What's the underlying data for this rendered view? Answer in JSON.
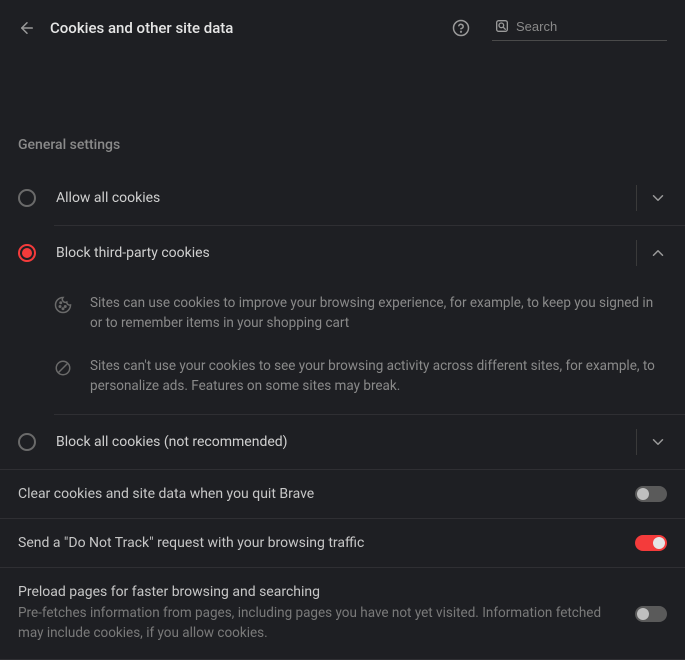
{
  "header": {
    "title": "Cookies and other site data",
    "search_placeholder": "Search"
  },
  "section_title": "General settings",
  "radios": {
    "allow_all": "Allow all cookies",
    "block_third": "Block third-party cookies",
    "block_all": "Block all cookies (not recommended)"
  },
  "block_third_details": {
    "line1": "Sites can use cookies to improve your browsing experience, for example, to keep you signed in or to remember items in your shopping cart",
    "line2": "Sites can't use your cookies to see your browsing activity across different sites, for example, to personalize ads. Features on some sites may break."
  },
  "toggles": {
    "clear_on_quit": "Clear cookies and site data when you quit Brave",
    "dnt": "Send a \"Do Not Track\" request with your browsing traffic",
    "preload_title": "Preload pages for faster browsing and searching",
    "preload_sub": "Pre-fetches information from pages, including pages you have not yet visited. Information fetched may include cookies, if you allow cookies."
  }
}
